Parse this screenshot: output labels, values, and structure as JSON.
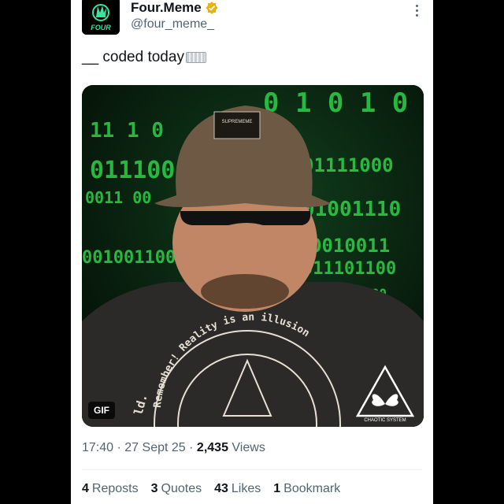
{
  "author": {
    "name": "Four.Meme",
    "handle": "@four_meme_",
    "avatar_text": "FOUR",
    "verified_color": "#e8b10b"
  },
  "tweet": {
    "text": "__ coded today",
    "keyboard_emoji": "keyboard-emoji"
  },
  "media": {
    "badge": "GIF",
    "binary_rows": [
      "0 1 0 1 0",
      "11 1 0",
      "01111000",
      "0111000",
      "01001110",
      "0011 00",
      "001001100",
      "0010011",
      "011101100",
      "11000100"
    ],
    "shirt_text": "Remember! Reality is an illusion",
    "shirt_text_left": "ld.",
    "hat_label": "SUPREMEME",
    "logo_text": "CHAOTIC SYSTEM",
    "colors": {
      "matrix_green": "#2fd14a",
      "shirt": "#2b2a28",
      "hat": "#6e5a44"
    }
  },
  "meta": {
    "time": "17:40",
    "date": "27 Sept 25",
    "views_count": "2,435",
    "views_label": "Views",
    "sep": "·"
  },
  "stats": [
    {
      "count": "4",
      "label": "Reposts"
    },
    {
      "count": "3",
      "label": "Quotes"
    },
    {
      "count": "43",
      "label": "Likes"
    },
    {
      "count": "1",
      "label": "Bookmark"
    }
  ]
}
